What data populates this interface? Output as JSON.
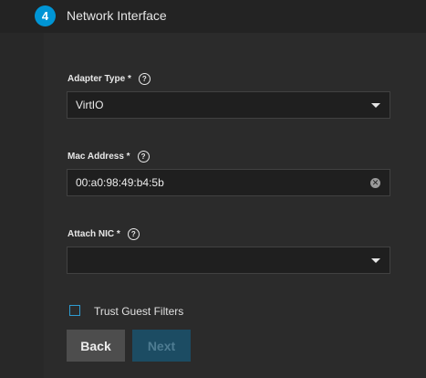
{
  "step": {
    "number": "4",
    "title": "Network Interface"
  },
  "fields": {
    "adapter_type": {
      "label": "Adapter Type *",
      "value": "VirtIO"
    },
    "mac_address": {
      "label": "Mac Address *",
      "value": "00:a0:98:49:b4:5b"
    },
    "attach_nic": {
      "label": "Attach NIC *",
      "value": ""
    }
  },
  "help_glyph": "?",
  "clear_glyph": "✕",
  "checkbox": {
    "label": "Trust Guest Filters",
    "checked": false
  },
  "buttons": {
    "back": "Back",
    "next": "Next"
  },
  "colors": {
    "accent": "#0095d5",
    "background": "#282828",
    "input_background": "#1f1f1f",
    "next_disabled": "#1c4c63",
    "back_button": "#4d4d4d"
  },
  "icons": {
    "help": "help-icon",
    "dropdown": "chevron-down-icon",
    "clear": "clear-icon"
  }
}
